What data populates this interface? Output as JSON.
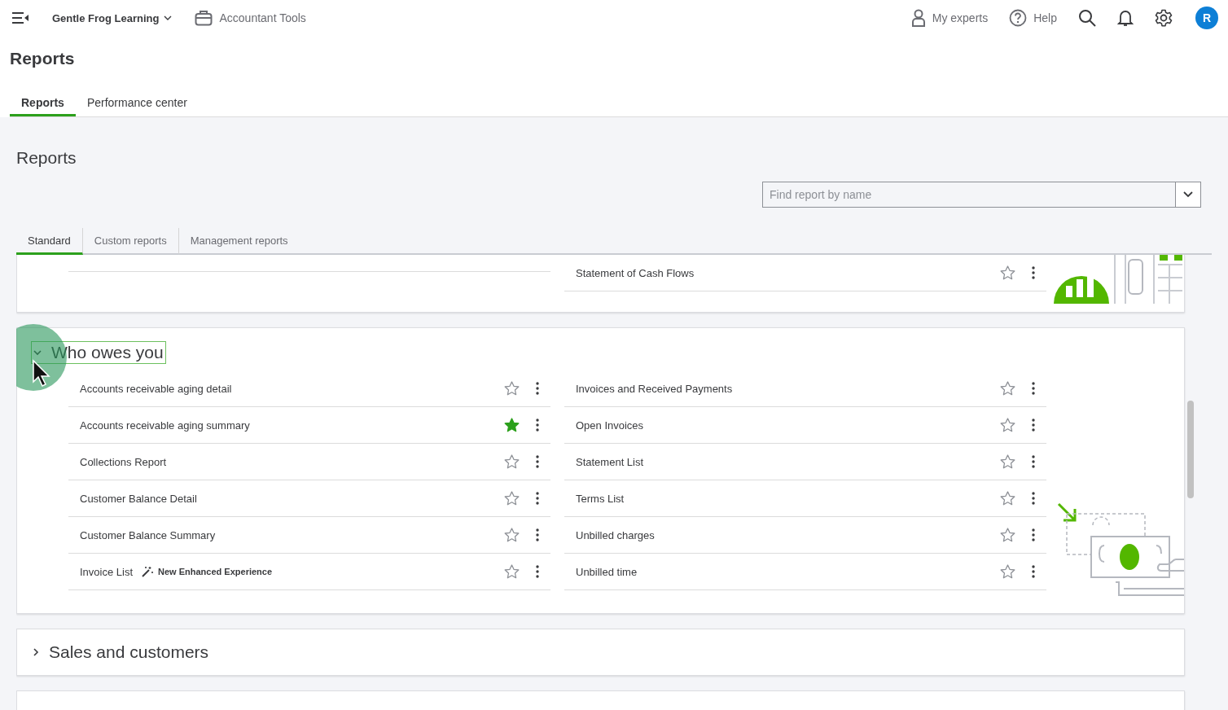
{
  "top_bar": {
    "company": "Gentle Frog Learning",
    "accountant_tools": "Accountant Tools",
    "my_experts": "My experts",
    "help": "Help",
    "avatar": "R"
  },
  "page_title": "Reports",
  "page_tabs": [
    {
      "label": "Reports",
      "selected": true
    },
    {
      "label": "Performance center",
      "selected": false
    }
  ],
  "section_title": "Reports",
  "search": {
    "placeholder": "Find report by name"
  },
  "report_tabs": [
    {
      "label": "Standard",
      "selected": true
    },
    {
      "label": "Custom reports",
      "selected": false
    },
    {
      "label": "Management reports",
      "selected": false
    }
  ],
  "partial_group": {
    "right_rows": [
      {
        "name": "Statement of Cash Flows",
        "favorite": false
      }
    ]
  },
  "groups": [
    {
      "title": "Who owes you",
      "expanded": true,
      "focused": true,
      "left_rows": [
        {
          "name": "Accounts receivable aging detail",
          "favorite": false
        },
        {
          "name": "Accounts receivable aging summary",
          "favorite": true
        },
        {
          "name": "Collections Report",
          "favorite": false
        },
        {
          "name": "Customer Balance Detail",
          "favorite": false
        },
        {
          "name": "Customer Balance Summary",
          "favorite": false
        },
        {
          "name": "Invoice List",
          "favorite": false,
          "badge": "New Enhanced Experience"
        }
      ],
      "right_rows": [
        {
          "name": "Invoices and Received Payments",
          "favorite": false
        },
        {
          "name": "Open Invoices",
          "favorite": false
        },
        {
          "name": "Statement List",
          "favorite": false
        },
        {
          "name": "Terms List",
          "favorite": false
        },
        {
          "name": "Unbilled charges",
          "favorite": false
        },
        {
          "name": "Unbilled time",
          "favorite": false
        }
      ]
    },
    {
      "title": "Sales and customers",
      "expanded": false,
      "focused": false
    }
  ]
}
